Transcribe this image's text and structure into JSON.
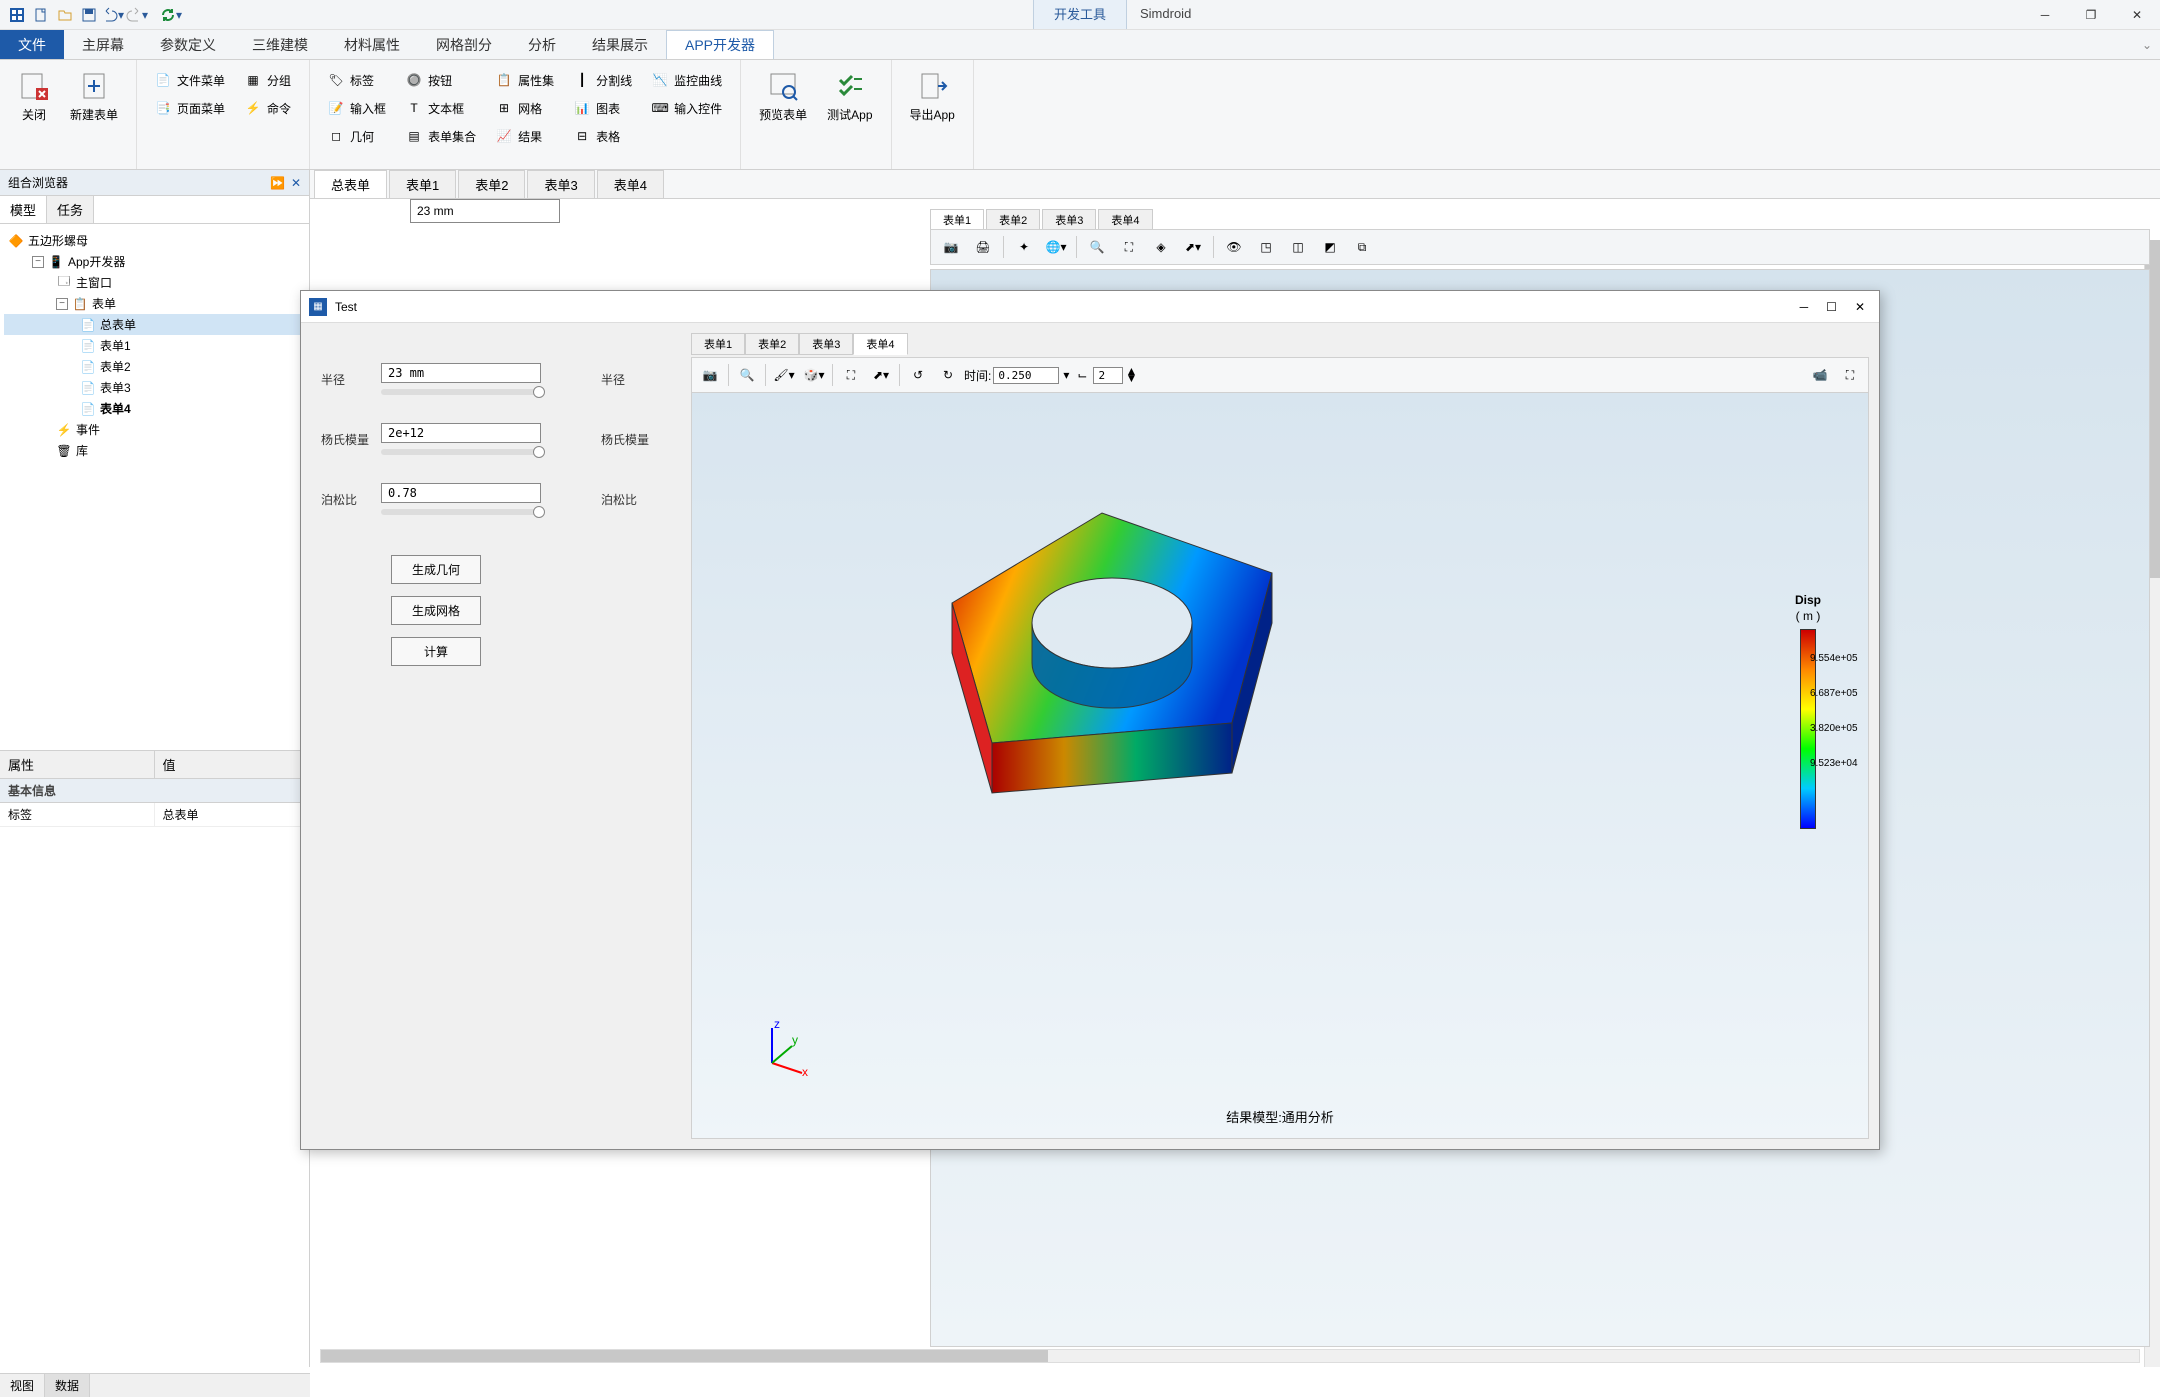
{
  "app": {
    "title": "Simdroid",
    "dev_tool_tab": "开发工具"
  },
  "ribbon": {
    "file": "文件",
    "tabs": [
      "主屏幕",
      "参数定义",
      "三维建模",
      "材料属性",
      "网格剖分",
      "分析",
      "结果展示",
      "APP开发器"
    ],
    "active": "APP开发器",
    "close": "关闭",
    "new_form": "新建表单",
    "file_menu": "文件菜单",
    "page_menu": "页面菜单",
    "group": "分组",
    "command": "命令",
    "label": "标签",
    "input_box": "输入框",
    "geometry": "几何",
    "button": "按钮",
    "text_box": "文本框",
    "form_set": "表单集合",
    "prop_set": "属性集",
    "mesh": "网格",
    "result": "结果",
    "split_line": "分割线",
    "chart": "图表",
    "table": "表格",
    "monitor_curve": "监控曲线",
    "input_ctrl": "输入控件",
    "preview_form": "预览表单",
    "test_app": "测试App",
    "export_app": "导出App"
  },
  "browser": {
    "title": "组合浏览器",
    "tabs": {
      "model": "模型",
      "task": "任务"
    },
    "tree": {
      "root": "五边形螺母",
      "app_dev": "App开发器",
      "main_window": "主窗口",
      "forms": "表单",
      "form_items": [
        "总表单",
        "表单1",
        "表单2",
        "表单3",
        "表单4"
      ],
      "events": "事件",
      "library": "库"
    }
  },
  "props": {
    "attr": "属性",
    "value": "值",
    "section": "基本信息",
    "label_key": "标签",
    "label_val": "总表单"
  },
  "center": {
    "tabs": [
      "总表单",
      "表单1",
      "表单2",
      "表单3",
      "表单4"
    ],
    "inner_tabs": [
      "表单1",
      "表单2",
      "表单3",
      "表单4"
    ],
    "partial_input": "23 mm"
  },
  "test_window": {
    "title": "Test",
    "inner_tabs": [
      "表单1",
      "表单2",
      "表单3",
      "表单4"
    ],
    "form": {
      "radius_label": "半径",
      "radius_value": "23 mm",
      "radius_display": "半径",
      "youngs_label": "杨氏模量",
      "youngs_value": "2e+12",
      "youngs_display": "杨氏模量",
      "poisson_label": "泊松比",
      "poisson_value": "0.78",
      "poisson_display": "泊松比",
      "btn_geom": "生成几何",
      "btn_mesh": "生成网格",
      "btn_calc": "计算"
    },
    "toolbar": {
      "time_label": "时间:",
      "time_value": "0.250",
      "step_value": "2"
    },
    "legend": {
      "title": "Disp",
      "unit": "( m )",
      "vals": [
        "9.554e+05",
        "6.687e+05",
        "3.820e+05",
        "9.523e+04"
      ]
    },
    "result_label": "结果模型:通用分析"
  },
  "bottom_tabs": {
    "view": "视图",
    "data": "数据"
  }
}
